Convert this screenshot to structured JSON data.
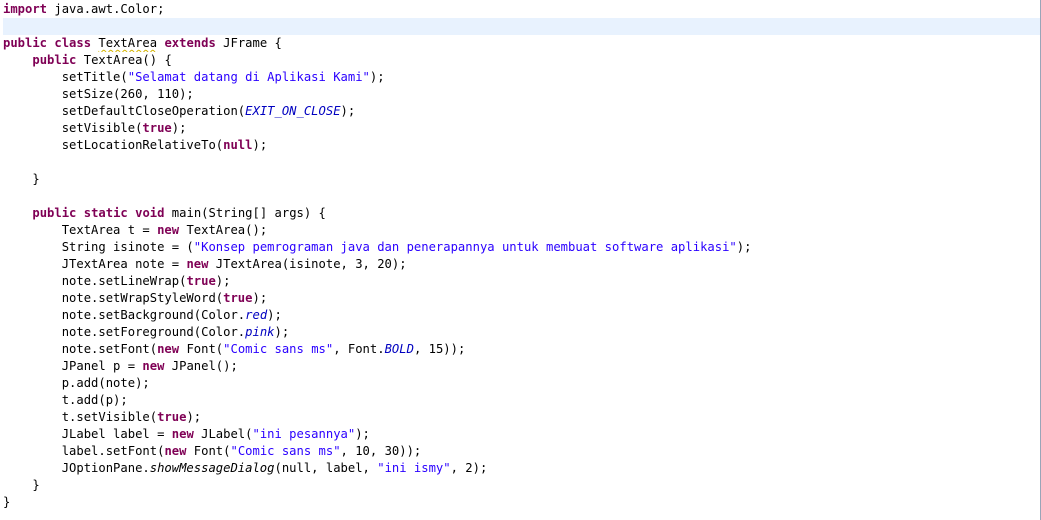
{
  "editor": {
    "lines": [
      [
        {
          "t": "import",
          "k": "kw"
        },
        {
          "t": " java.awt.Color;"
        }
      ],
      [],
      [
        {
          "t": "public",
          "k": "kw"
        },
        {
          "t": " "
        },
        {
          "t": "class",
          "k": "kw"
        },
        {
          "t": " "
        },
        {
          "t": "TextArea",
          "k": "squiggle"
        },
        {
          "t": " "
        },
        {
          "t": "extends",
          "k": "kw"
        },
        {
          "t": " JFrame {"
        }
      ],
      [
        {
          "t": "    "
        },
        {
          "t": "public",
          "k": "kw"
        },
        {
          "t": " TextArea() {"
        }
      ],
      [
        {
          "t": "        setTitle("
        },
        {
          "t": "\"Selamat datang di Aplikasi Kami\"",
          "k": "str"
        },
        {
          "t": ");"
        }
      ],
      [
        {
          "t": "        setSize(260, 110);"
        }
      ],
      [
        {
          "t": "        setDefaultCloseOperation("
        },
        {
          "t": "EXIT_ON_CLOSE",
          "k": "fld"
        },
        {
          "t": ");"
        }
      ],
      [
        {
          "t": "        setVisible("
        },
        {
          "t": "true",
          "k": "kw"
        },
        {
          "t": ");"
        }
      ],
      [
        {
          "t": "        setLocationRelativeTo("
        },
        {
          "t": "null",
          "k": "kw"
        },
        {
          "t": ");"
        }
      ],
      [],
      [
        {
          "t": "    }"
        }
      ],
      [],
      [
        {
          "t": "    "
        },
        {
          "t": "public",
          "k": "kw"
        },
        {
          "t": " "
        },
        {
          "t": "static",
          "k": "kw"
        },
        {
          "t": " "
        },
        {
          "t": "void",
          "k": "kw"
        },
        {
          "t": " main(String[] args) {"
        }
      ],
      [
        {
          "t": "        TextArea t = "
        },
        {
          "t": "new",
          "k": "kw"
        },
        {
          "t": " TextArea();"
        }
      ],
      [
        {
          "t": "        String isinote = ("
        },
        {
          "t": "\"Konsep pemrograman java dan penerapannya untuk membuat software aplikasi\"",
          "k": "str"
        },
        {
          "t": ");"
        }
      ],
      [
        {
          "t": "        JTextArea note = "
        },
        {
          "t": "new",
          "k": "kw"
        },
        {
          "t": " JTextArea(isinote, 3, 20);"
        }
      ],
      [
        {
          "t": "        note.setLineWrap("
        },
        {
          "t": "true",
          "k": "kw"
        },
        {
          "t": ");"
        }
      ],
      [
        {
          "t": "        note.setWrapStyleWord("
        },
        {
          "t": "true",
          "k": "kw"
        },
        {
          "t": ");"
        }
      ],
      [
        {
          "t": "        note.setBackground(Color."
        },
        {
          "t": "red",
          "k": "fld"
        },
        {
          "t": ");"
        }
      ],
      [
        {
          "t": "        note.setForeground(Color."
        },
        {
          "t": "pink",
          "k": "fld"
        },
        {
          "t": ");"
        }
      ],
      [
        {
          "t": "        note.setFont("
        },
        {
          "t": "new",
          "k": "kw"
        },
        {
          "t": " Font("
        },
        {
          "t": "\"Comic sans ms\"",
          "k": "str"
        },
        {
          "t": ", Font."
        },
        {
          "t": "BOLD",
          "k": "fld"
        },
        {
          "t": ", 15));"
        }
      ],
      [
        {
          "t": "        JPanel p = "
        },
        {
          "t": "new",
          "k": "kw"
        },
        {
          "t": " JPanel();"
        }
      ],
      [
        {
          "t": "        p.add(note);"
        }
      ],
      [
        {
          "t": "        t.add(p);"
        }
      ],
      [
        {
          "t": "        t.setVisible("
        },
        {
          "t": "true",
          "k": "kw"
        },
        {
          "t": ");"
        }
      ],
      [
        {
          "t": "        JLabel label = "
        },
        {
          "t": "new",
          "k": "kw"
        },
        {
          "t": " JLabel("
        },
        {
          "t": "\"ini pesannya\"",
          "k": "str"
        },
        {
          "t": ");"
        }
      ],
      [
        {
          "t": "        label.setFont("
        },
        {
          "t": "new",
          "k": "kw"
        },
        {
          "t": " Font("
        },
        {
          "t": "\"Comic sans ms\"",
          "k": "str"
        },
        {
          "t": ", 10, 30));"
        }
      ],
      [
        {
          "t": "        JOptionPane."
        },
        {
          "t": "showMessageDialog",
          "k": "sta"
        },
        {
          "t": "(null, label, "
        },
        {
          "t": "\"ini ismy\"",
          "k": "str"
        },
        {
          "t": ", 2);"
        }
      ],
      [
        {
          "t": "    }"
        }
      ],
      [
        {
          "t": "}"
        }
      ]
    ],
    "current_line": 1
  }
}
